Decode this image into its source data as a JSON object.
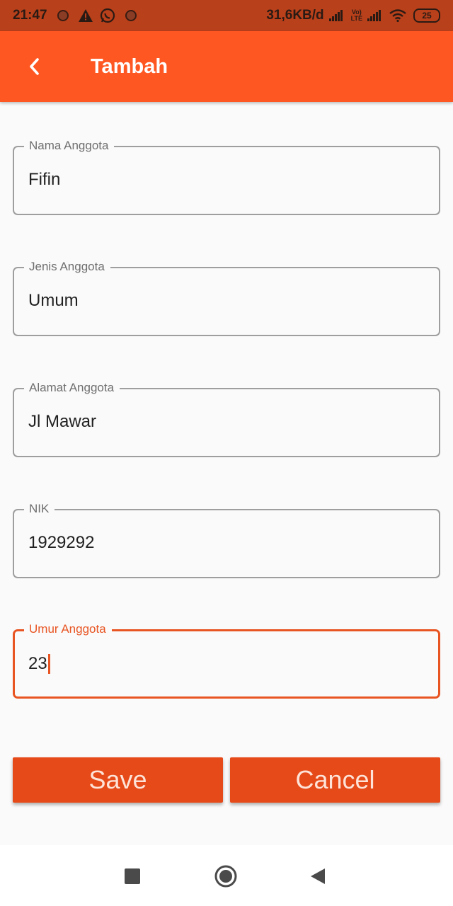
{
  "status_bar": {
    "time": "21:47",
    "network_speed": "31,6KB/d",
    "volte_top": "Vo)",
    "volte_bottom": "LTE",
    "battery": "25"
  },
  "app_bar": {
    "title": "Tambah",
    "back_icon": "chevron-left-icon"
  },
  "form": {
    "fields": [
      {
        "label": "Nama Anggota",
        "value": "Fifin"
      },
      {
        "label": "Jenis Anggota",
        "value": "Umum"
      },
      {
        "label": "Alamat Anggota",
        "value": "Jl Mawar"
      },
      {
        "label": "NIK",
        "value": "1929292"
      },
      {
        "label": "Umur Anggota",
        "value": "23"
      }
    ],
    "save_label": "Save",
    "cancel_label": "Cancel"
  },
  "colors": {
    "accent": "#ff5722",
    "button": "#e64a19",
    "status_bar": "#b8401a"
  }
}
